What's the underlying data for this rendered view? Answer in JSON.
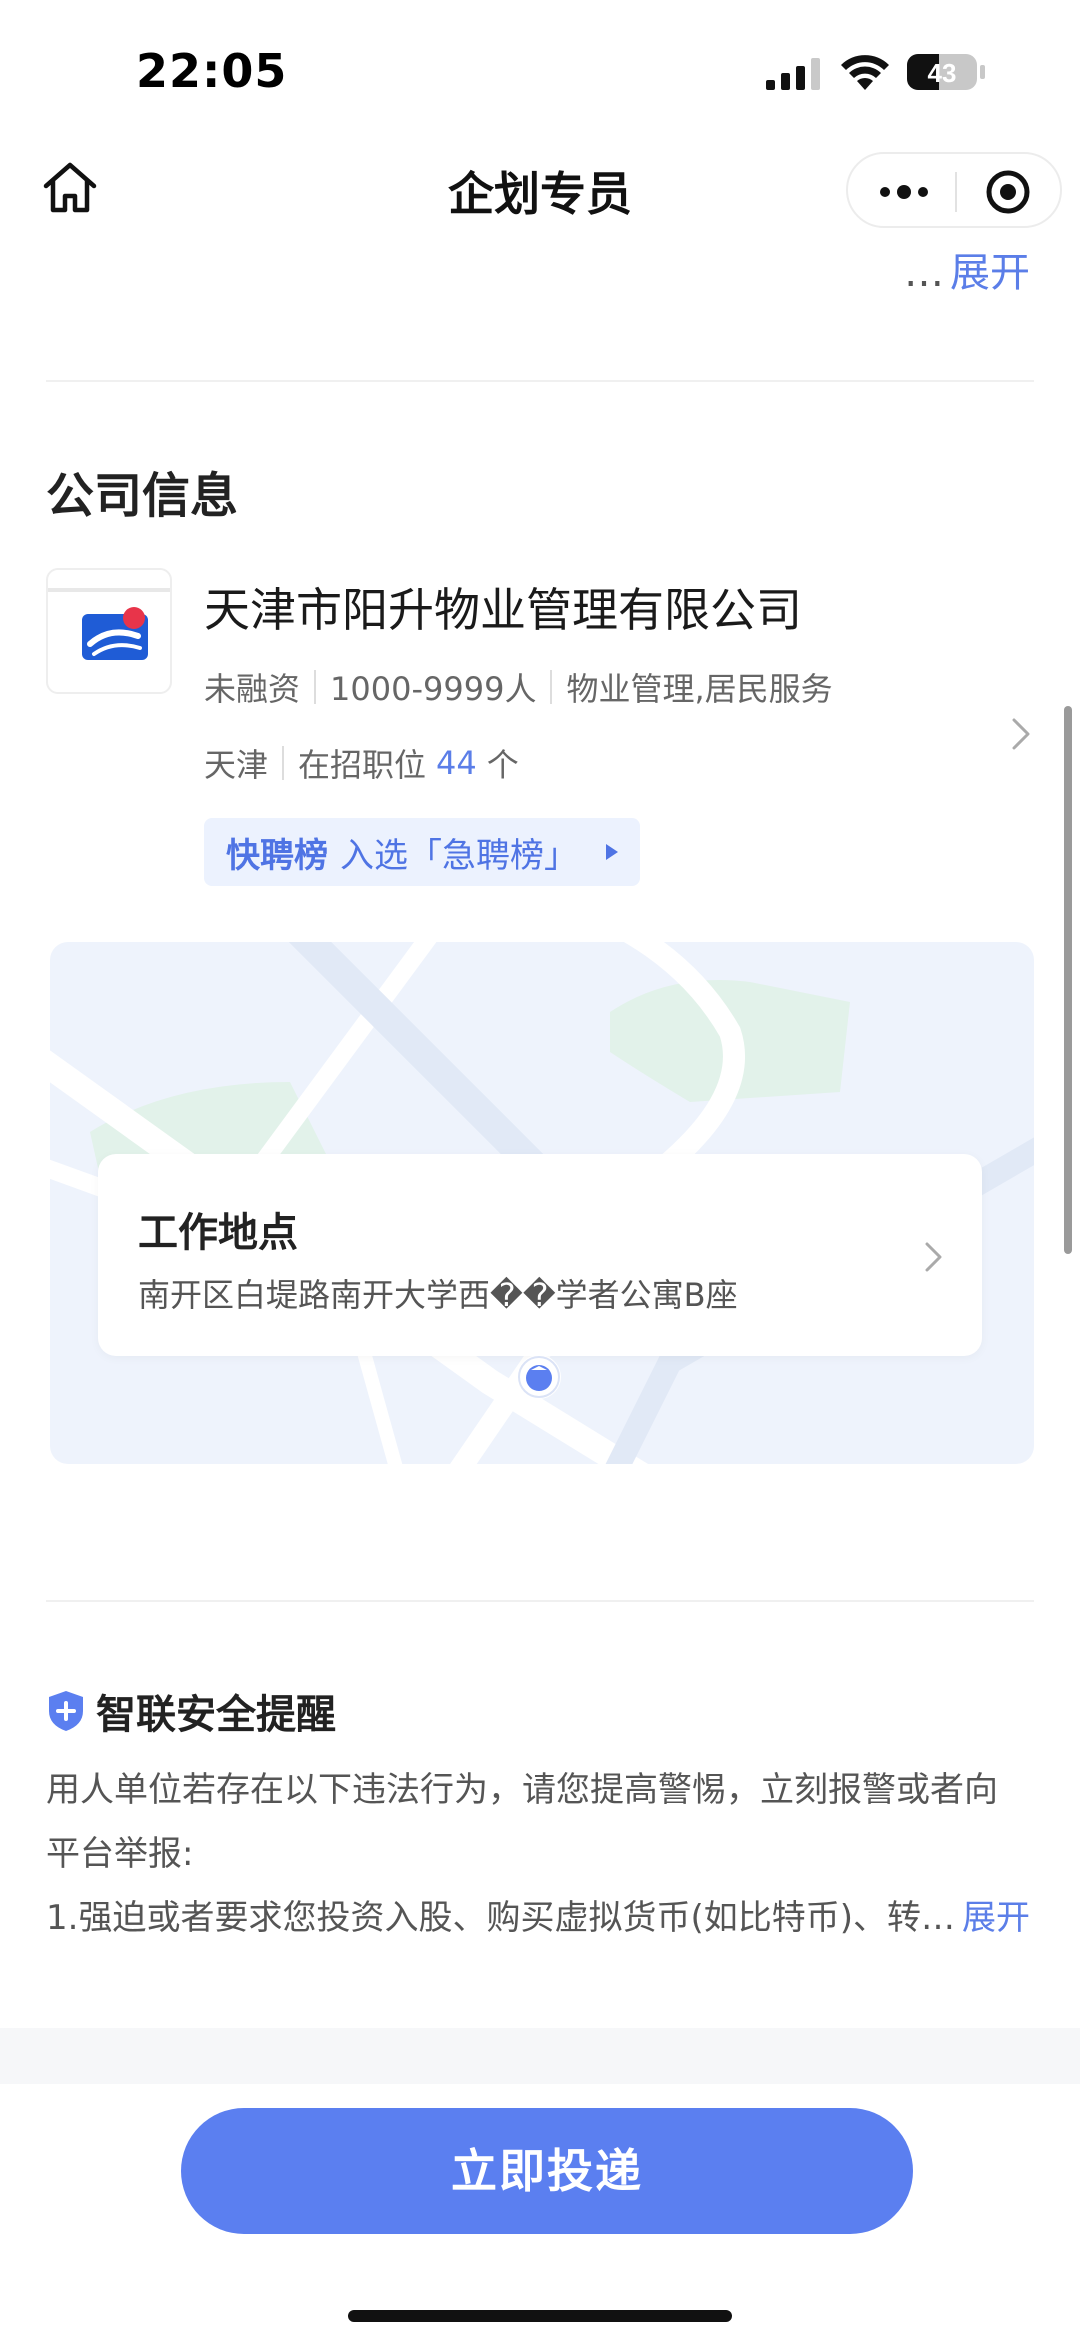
{
  "status_bar": {
    "time": "22:05",
    "battery": "43"
  },
  "nav": {
    "title": "企划专员"
  },
  "expand_top": {
    "dots": "…",
    "label": "展开"
  },
  "company_section": {
    "title": "公司信息"
  },
  "company": {
    "name": "天津市阳升物业管理有限公司",
    "funding": "未融资",
    "size": "1000-9999人",
    "industry": "物业管理,居民服务",
    "city": "天津",
    "jobs_prefix": "在招职位",
    "jobs_count": "44",
    "jobs_suffix": "个",
    "rank_name": "快聘榜",
    "rank_text": "入选「急聘榜」"
  },
  "location": {
    "title": "工作地点",
    "address": "南开区白堤路南开大学西��学者公寓B座"
  },
  "safety": {
    "title": "智联安全提醒",
    "line1": "用人单位若存在以下违法行为，请您提高警惕，立刻报警或者向",
    "line2": "平台举报:",
    "line3": "1.强迫或者要求您投资入股、购买虚拟货币(如比特币)、转…",
    "more": "展开"
  },
  "apply": {
    "label": "立即投递"
  },
  "colors": {
    "accent": "#5b7ff0",
    "link": "#5b7ee8"
  }
}
